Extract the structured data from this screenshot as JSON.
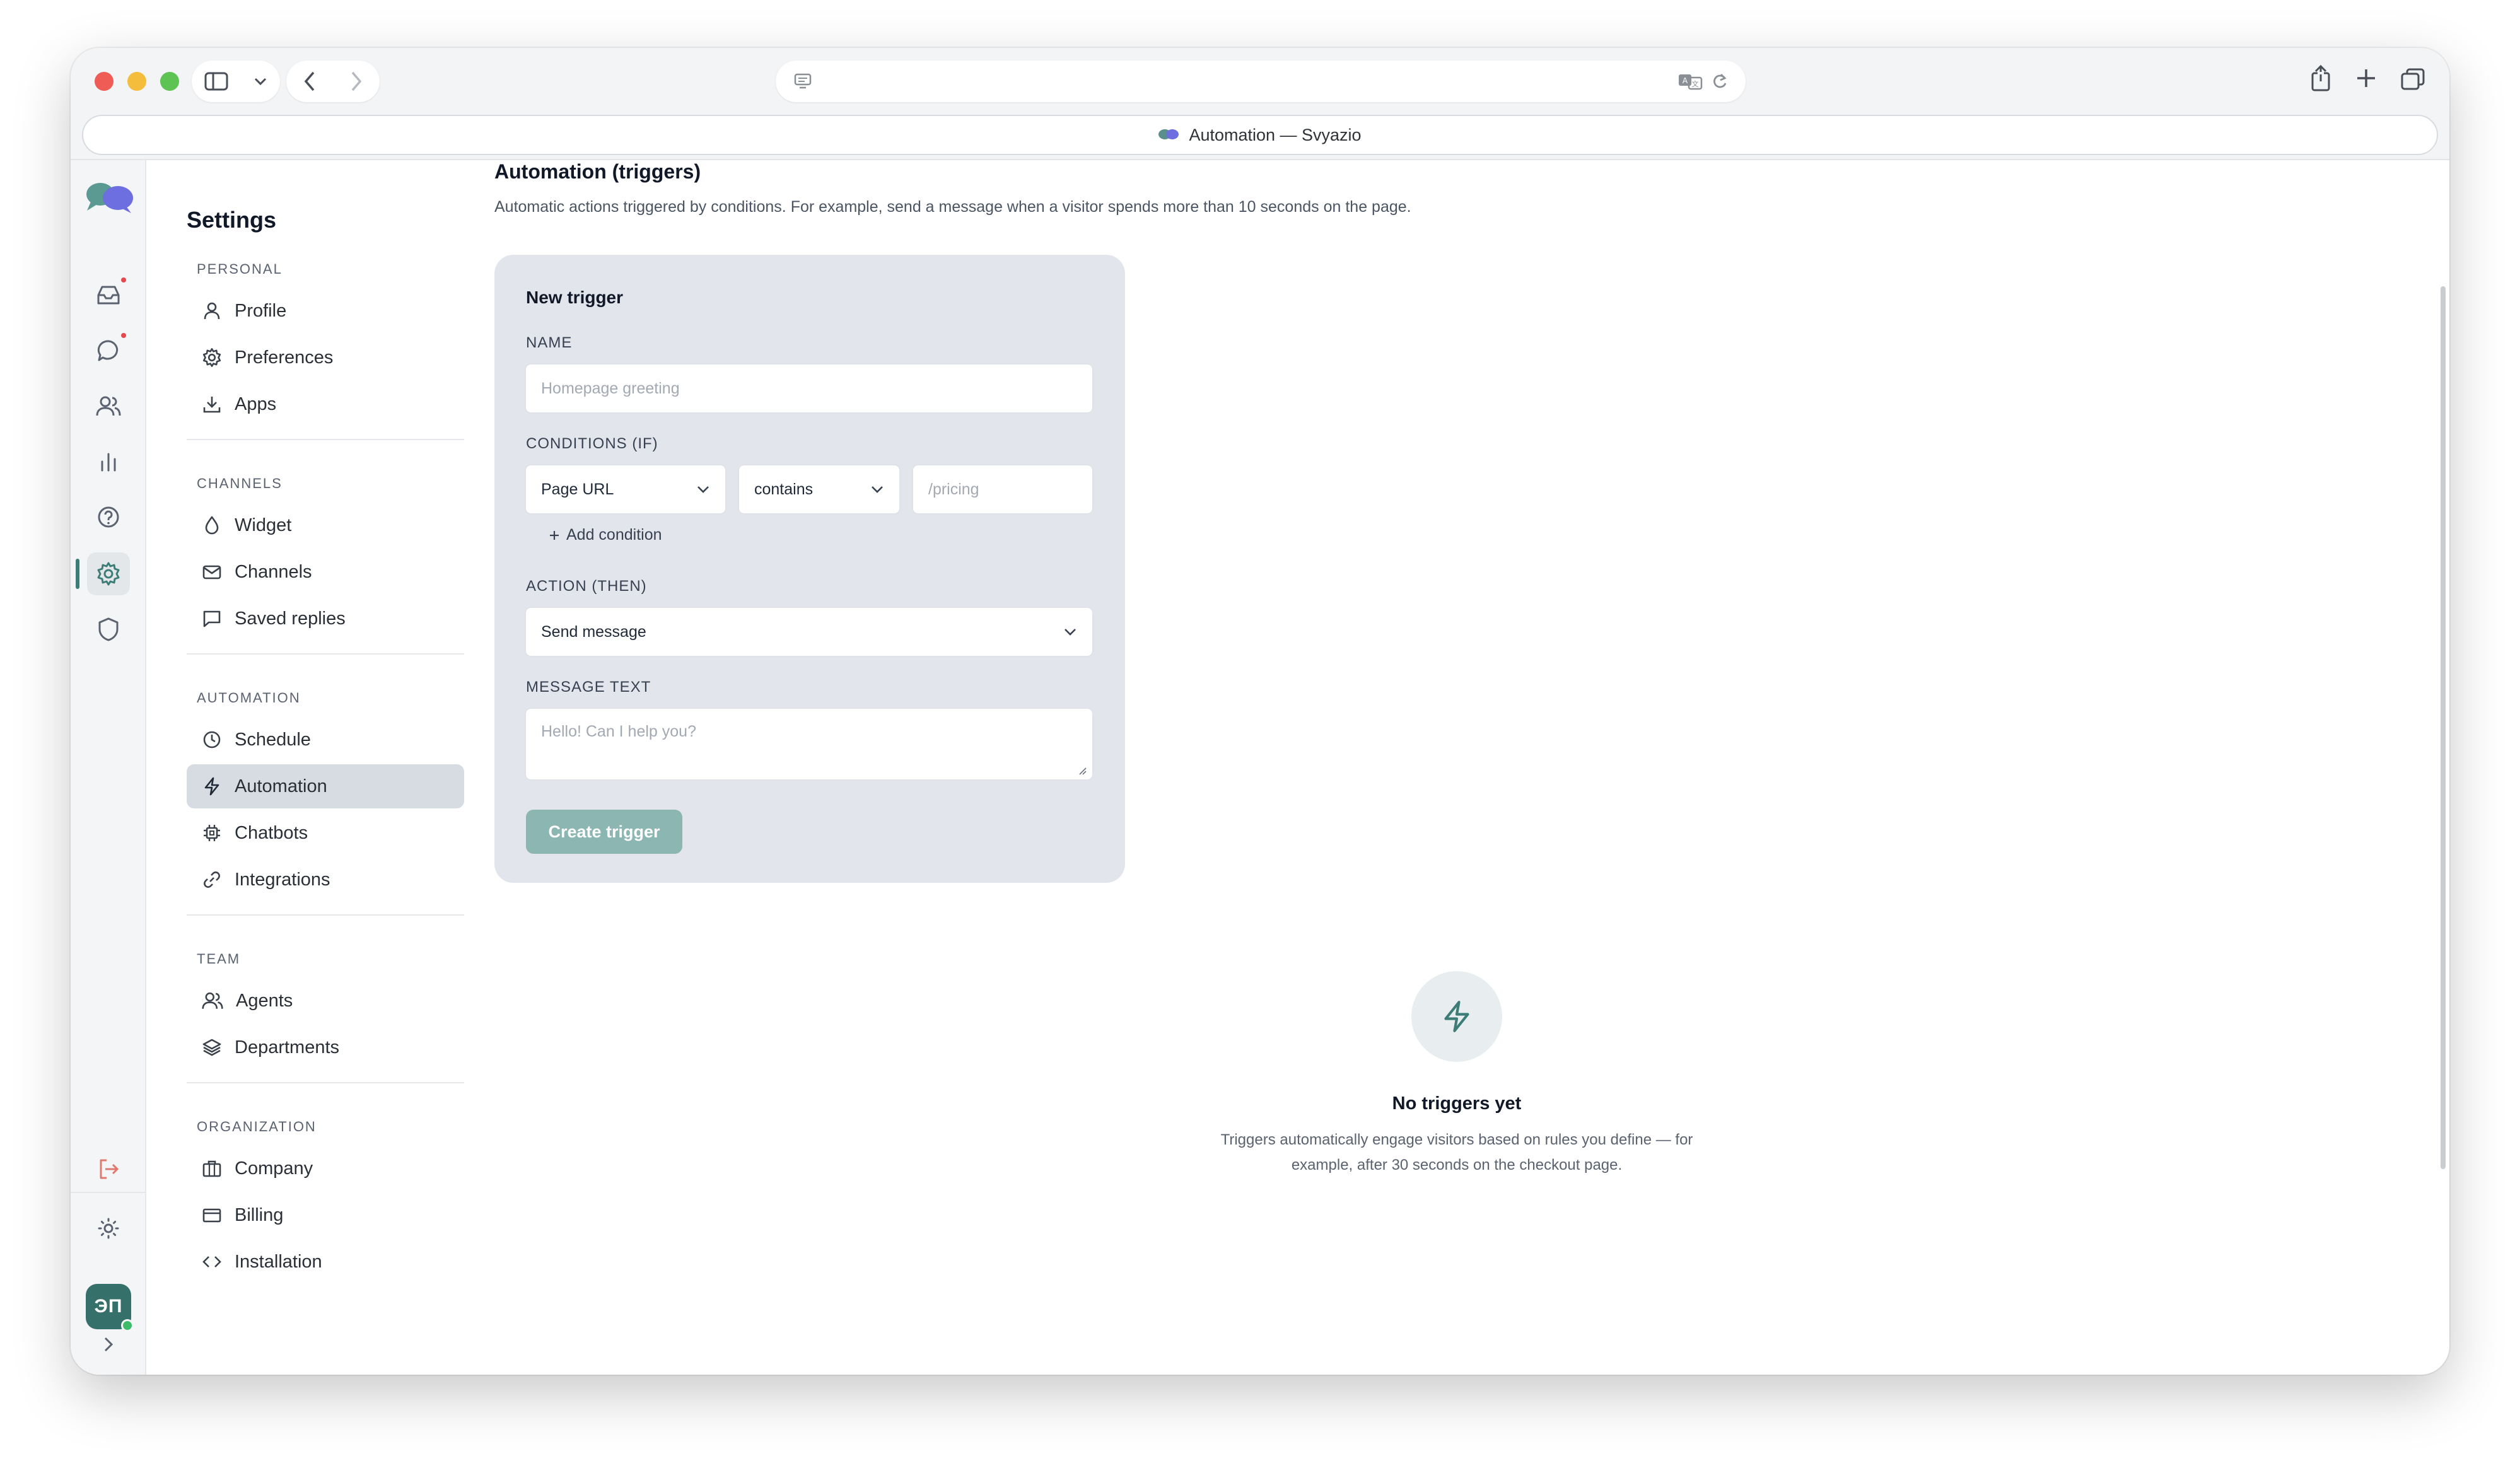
{
  "browser": {
    "tab_title": "Automation — Svyazio"
  },
  "app": {
    "avatar_initials": "ЭП",
    "settings_title": "Settings",
    "sections": {
      "personal": "PERSONAL",
      "channels": "CHANNELS",
      "automation": "AUTOMATION",
      "team": "TEAM",
      "organization": "ORGANIZATION"
    },
    "nav": {
      "profile": "Profile",
      "preferences": "Preferences",
      "apps": "Apps",
      "widget": "Widget",
      "channels": "Channels",
      "saved_replies": "Saved replies",
      "schedule": "Schedule",
      "automation": "Automation",
      "chatbots": "Chatbots",
      "integrations": "Integrations",
      "agents": "Agents",
      "departments": "Departments",
      "company": "Company",
      "billing": "Billing",
      "installation": "Installation"
    }
  },
  "main": {
    "title": "Automation (triggers)",
    "description": "Automatic actions triggered by conditions. For example, send a message when a visitor spends more than 10 seconds on the page.",
    "form": {
      "title": "New trigger",
      "name_label": "NAME",
      "name_placeholder": "Homepage greeting",
      "conditions_label": "CONDITIONS (IF)",
      "condition_field": "Page URL",
      "condition_operator": "contains",
      "condition_value_placeholder": "/pricing",
      "add_condition": "Add condition",
      "action_label": "ACTION (THEN)",
      "action_value": "Send message",
      "message_label": "MESSAGE TEXT",
      "message_placeholder": "Hello! Can I help you?",
      "create_button": "Create trigger"
    },
    "empty_state": {
      "title": "No triggers yet",
      "description": "Triggers automatically engage visitors based on rules you define — for example, after 30 seconds on the checkout page."
    }
  },
  "colors": {
    "accent": "#3c7d77",
    "button_disabled": "#8bb6b1",
    "card_bg": "#e2e6ec",
    "notification_dot": "#e5484d"
  }
}
